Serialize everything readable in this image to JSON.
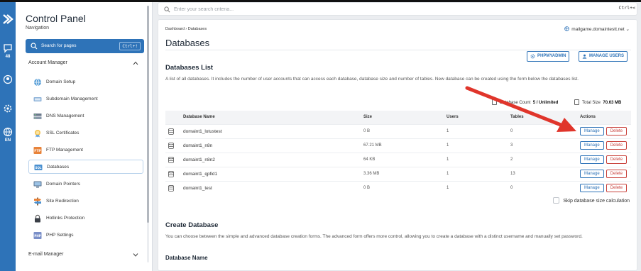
{
  "sidebar": {
    "title": "Control Panel",
    "subtitle": "Navigation",
    "search_label": "Search for pages",
    "search_shortcut": "Ctrl+!",
    "section_account": "Account Manager",
    "section_email": "E-mail Manager",
    "items": [
      {
        "label": "Domain Setup",
        "icon": "globe-icon"
      },
      {
        "label": "Subdomain Management",
        "icon": "subdomain-icon"
      },
      {
        "label": "DNS Management",
        "icon": "dns-icon"
      },
      {
        "label": "SSL Certificates",
        "icon": "certificate-icon"
      },
      {
        "label": "FTP Management",
        "icon": "ftp-icon"
      },
      {
        "label": "Databases",
        "icon": "database-icon"
      },
      {
        "label": "Domain Pointers",
        "icon": "monitor-icon"
      },
      {
        "label": "Site Redirection",
        "icon": "redirect-icon"
      },
      {
        "label": "Hotlinks Protection",
        "icon": "lock-icon"
      },
      {
        "label": "PHP Settings",
        "icon": "php-icon"
      }
    ]
  },
  "rail": {
    "badge_48": "48",
    "lang": "EN"
  },
  "topsearch": {
    "placeholder": "Enter your search criteria...",
    "shortcut": "Ctrl+<"
  },
  "main": {
    "breadcrumb": "Dashboard › Databases",
    "domain": "mailgame.domaintestt.net",
    "title": "Databases",
    "btn_phpmyadmin": "PHPMYADMIN",
    "btn_manage_users": "MANAGE USERS",
    "list_title": "Databases List",
    "list_desc": "A list of all databases. It includes the number of user accounts that can access each database, database size and number of tables. New database can be created using the form below the databases list.",
    "db_count_label": "Database Count",
    "db_count_value": "5 / Unlimited",
    "total_size_label": "Total Size",
    "total_size_value": "70.63 MB",
    "columns": [
      "Database Name",
      "Size",
      "Users",
      "Tables",
      "Actions"
    ],
    "rows": [
      {
        "name": "domaint1_lotustest",
        "size": "0 B",
        "users": "1",
        "tables": "0"
      },
      {
        "name": "domaint1_n8n",
        "size": "67.21 MB",
        "users": "1",
        "tables": "3"
      },
      {
        "name": "domaint1_n8n2",
        "size": "64 KB",
        "users": "1",
        "tables": "2"
      },
      {
        "name": "domaint1_qpfid1",
        "size": "3.36 MB",
        "users": "1",
        "tables": "13"
      },
      {
        "name": "domaint1_test",
        "size": "0 B",
        "users": "1",
        "tables": "0"
      }
    ],
    "manage_label": "Manage",
    "delete_label": "Delete",
    "skip_label": "Skip database size calculation",
    "create_title": "Create Database",
    "create_desc": "You can choose between the simple and advanced database creation forms. The advanced form offers more control, allowing you to create a database with a distinct username and manually set password.",
    "db_name_label": "Database Name"
  },
  "colors": {
    "accent": "#2e73b8",
    "danger": "#c9413b",
    "arrow": "#e0352b"
  }
}
